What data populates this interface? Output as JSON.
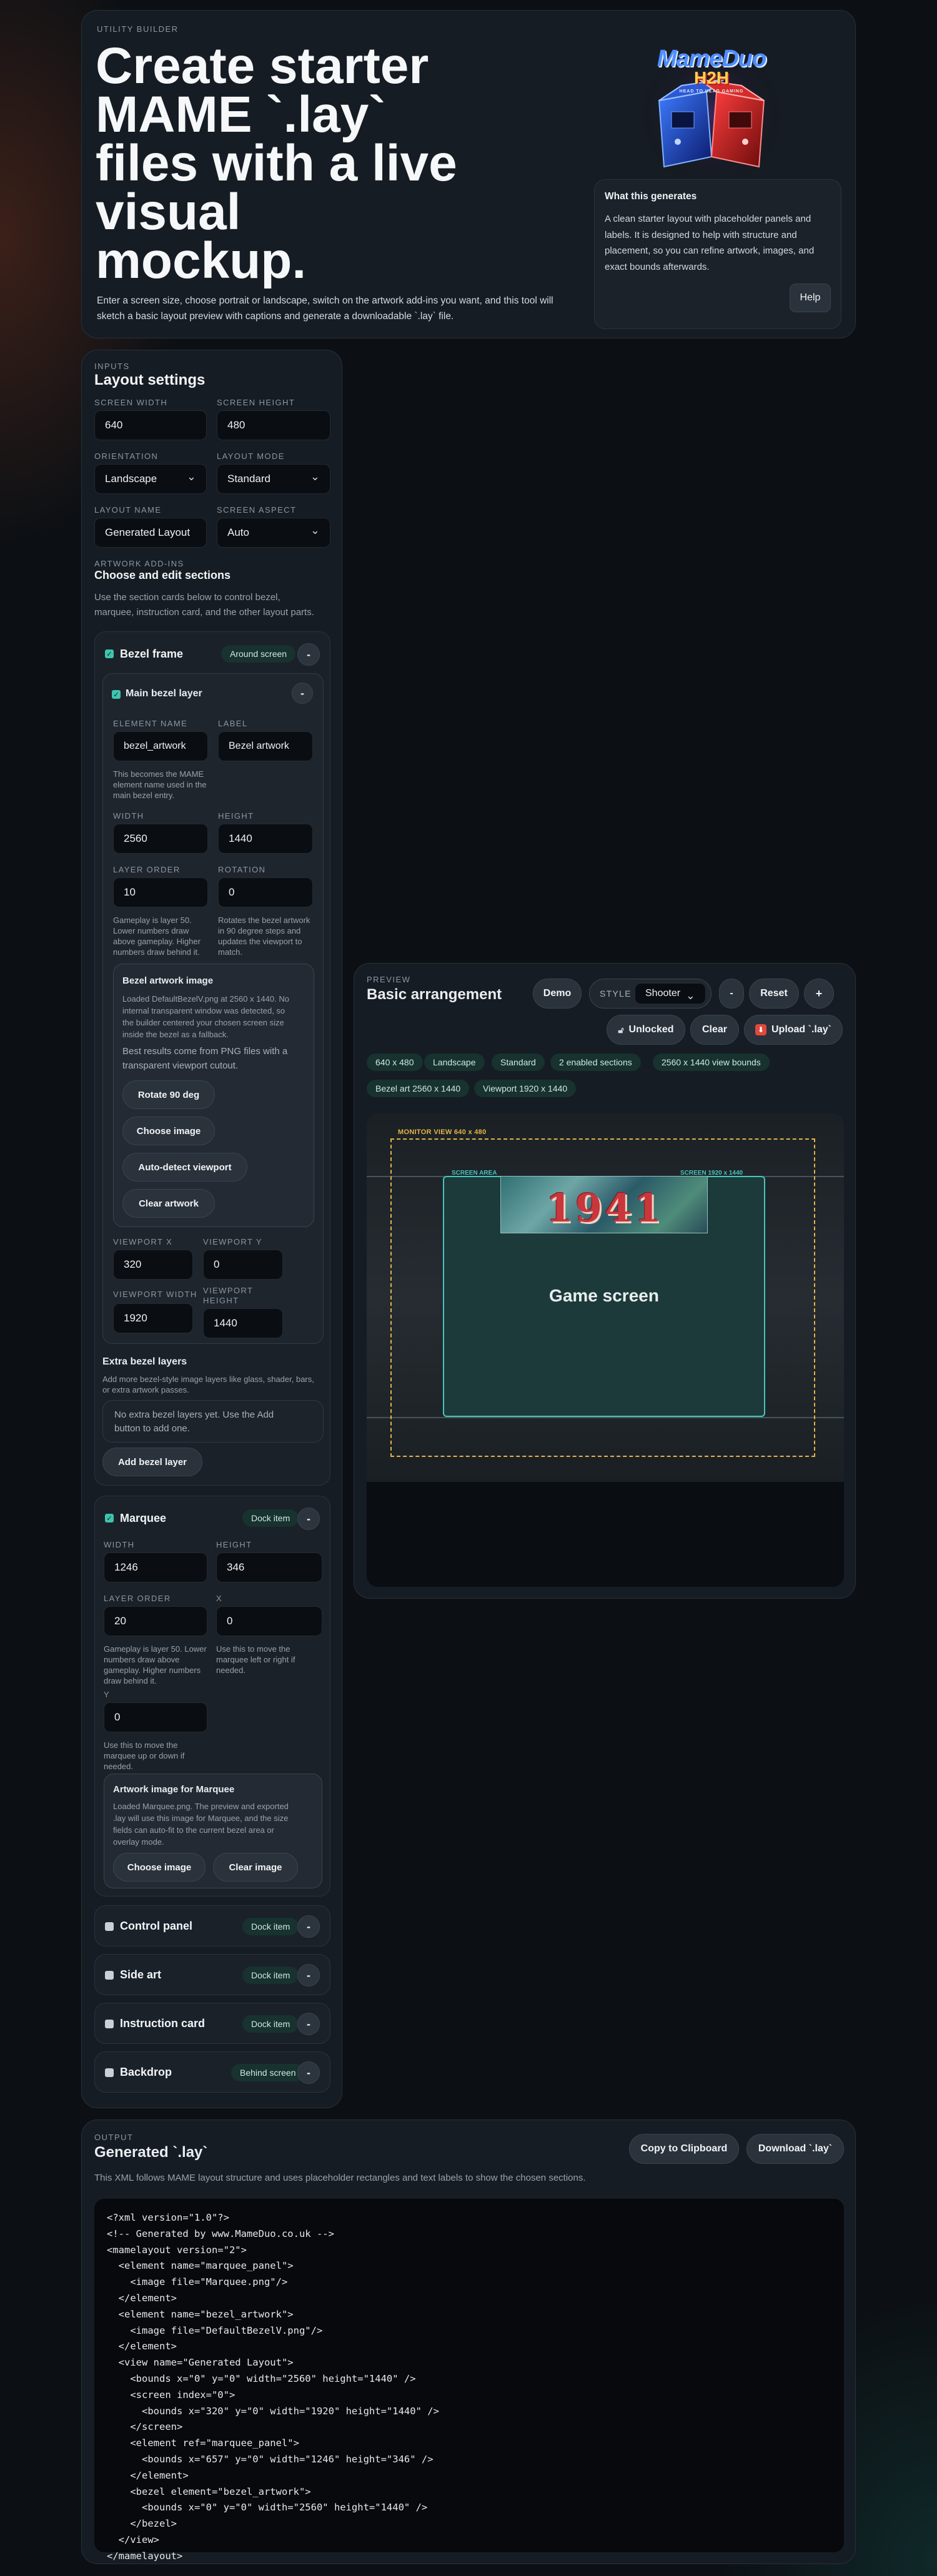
{
  "hero": {
    "eyebrow": "UTILITY BUILDER",
    "title_lines": [
      "Create starter",
      "MAME `.lay`",
      "files with a live",
      "visual",
      "mockup."
    ],
    "description_lines": [
      "Enter a screen size, choose portrait or landscape, switch on the artwork add-ins you want, and this tool will",
      "sketch a basic layout preview with captions and generate a downloadable `.lay` file."
    ],
    "logo": {
      "line1": "MameDuo",
      "line2": "H2H",
      "tagline": "HEAD TO HEAD GAMING",
      "icon": "arcade-cabinets-logo"
    },
    "info_box": {
      "title": "What this generates",
      "body_lines": [
        "A clean starter layout with placeholder panels and",
        "labels. It is designed to help with structure and",
        "placement, so you can refine artwork, images, and",
        "exact bounds afterwards."
      ],
      "help_label": "Help"
    }
  },
  "inputs": {
    "eyebrow": "INPUTS",
    "title": "Layout settings",
    "screen_width_label": "SCREEN WIDTH",
    "screen_width": "640",
    "screen_height_label": "SCREEN HEIGHT",
    "screen_height": "480",
    "orientation_label": "ORIENTATION",
    "orientation": "Landscape",
    "layout_mode_label": "LAYOUT MODE",
    "layout_mode": "Standard",
    "layout_name_label": "LAYOUT NAME",
    "layout_name": "Generated Layout",
    "screen_aspect_label": "SCREEN ASPECT",
    "screen_aspect": "Auto",
    "addins_eyebrow": "ARTWORK ADD-INS",
    "addins_title": "Choose and edit sections",
    "addins_desc_lines": [
      "Use the section cards below to control bezel,",
      "marquee, instruction card, and the other layout parts."
    ]
  },
  "bezel": {
    "title": "Bezel frame",
    "badge": "Around screen",
    "minus": "-",
    "main_layer": {
      "title": "Main bezel layer",
      "element_name_label": "ELEMENT NAME",
      "element_name": "bezel_artwork",
      "label_label": "LABEL",
      "label_value": "Bezel artwork",
      "element_help_lines": [
        "This becomes the MAME",
        "element name used in the",
        "main bezel entry."
      ],
      "width_label": "WIDTH",
      "width": "2560",
      "height_label": "HEIGHT",
      "height": "1440",
      "layer_order_label": "LAYER ORDER",
      "layer_order": "10",
      "rotation_label": "ROTATION",
      "rotation": "0",
      "layer_help_lines": [
        "Gameplay is layer 50.",
        "Lower numbers draw",
        "above gameplay. Higher",
        "numbers draw behind it."
      ],
      "rotation_help_lines": [
        "Rotates the bezel artwork",
        "in 90 degree steps and",
        "updates the viewport to",
        "match."
      ],
      "image_box": {
        "title": "Bezel artwork image",
        "desc_lines": [
          "Loaded DefaultBezelV.png at 2560 x 1440. No",
          "internal transparent window was detected, so",
          "the builder centered your chosen screen size",
          "inside the bezel as a fallback."
        ],
        "tip_lines": [
          "Best results come from PNG files with a",
          "transparent viewport cutout."
        ],
        "rotate_label": "Rotate 90 deg",
        "choose_label": "Choose image",
        "autodetect_label": "Auto-detect viewport",
        "clear_label": "Clear artwork"
      },
      "viewport_x_label": "VIEWPORT X",
      "viewport_x": "320",
      "viewport_y_label": "VIEWPORT Y",
      "viewport_y": "0",
      "viewport_width_label": "VIEWPORT WIDTH",
      "viewport_width": "1920",
      "viewport_height_label_lines": [
        "VIEWPORT",
        "HEIGHT"
      ],
      "viewport_height": "1440"
    },
    "extra": {
      "title": "Extra bezel layers",
      "desc_lines": [
        "Add more bezel-style image layers like glass, shader, bars,",
        "or extra artwork passes."
      ],
      "empty_lines": [
        "No extra bezel layers yet. Use the Add",
        "button to add one."
      ],
      "add_label": "Add bezel layer"
    }
  },
  "marquee": {
    "title": "Marquee",
    "badge": "Dock item",
    "width_label": "WIDTH",
    "width": "1246",
    "height_label": "HEIGHT",
    "height": "346",
    "layer_order_label": "LAYER ORDER",
    "layer_order": "20",
    "x_label": "X",
    "x_value": "0",
    "layer_help_lines": [
      "Gameplay is layer 50. Lower",
      "numbers draw above",
      "gameplay. Higher numbers",
      "draw behind it."
    ],
    "x_help_lines": [
      "Use this to move the",
      "marquee left or right if",
      "needed."
    ],
    "y_label": "Y",
    "y_value": "0",
    "y_help_lines": [
      "Use this to move the",
      "marquee up or down if",
      "needed."
    ],
    "image_box": {
      "title": "Artwork image for Marquee",
      "desc_lines": [
        "Loaded Marquee.png. The preview and exported",
        ".lay will use this image for Marquee, and the size",
        "fields can auto-fit to the current bezel area or",
        "overlay mode."
      ],
      "choose_label": "Choose image",
      "clear_label": "Clear image"
    }
  },
  "collapsed_sections": [
    {
      "title": "Control panel",
      "badge": "Dock item"
    },
    {
      "title": "Side art",
      "badge": "Dock item"
    },
    {
      "title": "Instruction card",
      "badge": "Dock item"
    },
    {
      "title": "Backdrop",
      "badge": "Behind screen"
    }
  ],
  "preview": {
    "eyebrow": "PREVIEW",
    "title": "Basic arrangement",
    "demo_label": "Demo",
    "style_label": "STYLE",
    "style_value": "Shooter",
    "minus_label": "-",
    "reset_label": "Reset",
    "plus_label": "+",
    "unlocked_label": "Unlocked",
    "clear_label": "Clear",
    "upload_label": "Upload `.lay`",
    "chips": [
      "640 x 480",
      "Landscape",
      "Standard",
      "2 enabled sections",
      "2560 x 1440 view bounds",
      "Bezel art 2560 x 1440",
      "Viewport 1920 x 1440"
    ],
    "monitor_label": "MONITOR VIEW 640 x 480",
    "screen_area_label": "SCREEN AREA",
    "screen_size_label": "SCREEN 1920 x 1440",
    "game_screen_label": "Game screen",
    "marquee_text": "1941",
    "accent": "#e2b54a",
    "screen_accent": "#45c6bd"
  },
  "output": {
    "eyebrow": "OUTPUT",
    "title": "Generated `.lay`",
    "desc": "This XML follows MAME layout structure and uses placeholder rectangles and text labels to show the chosen sections.",
    "copy_label": "Copy to Clipboard",
    "download_label": "Download `.lay`",
    "code_lines": [
      "<?xml version=\"1.0\"?>",
      "<!-- Generated by www.MameDuo.co.uk -->",
      "<mamelayout version=\"2\">",
      "  <element name=\"marquee_panel\">",
      "    <image file=\"Marquee.png\"/>",
      "  </element>",
      "  <element name=\"bezel_artwork\">",
      "    <image file=\"DefaultBezelV.png\"/>",
      "  </element>",
      "  <view name=\"Generated Layout\">",
      "    <bounds x=\"0\" y=\"0\" width=\"2560\" height=\"1440\" />",
      "    <screen index=\"0\">",
      "      <bounds x=\"320\" y=\"0\" width=\"1920\" height=\"1440\" />",
      "    </screen>",
      "    <element ref=\"marquee_panel\">",
      "      <bounds x=\"657\" y=\"0\" width=\"1246\" height=\"346\" />",
      "    </element>",
      "    <bezel element=\"bezel_artwork\">",
      "      <bounds x=\"0\" y=\"0\" width=\"2560\" height=\"1440\" />",
      "    </bezel>",
      "  </view>",
      "</mamelayout>"
    ]
  }
}
